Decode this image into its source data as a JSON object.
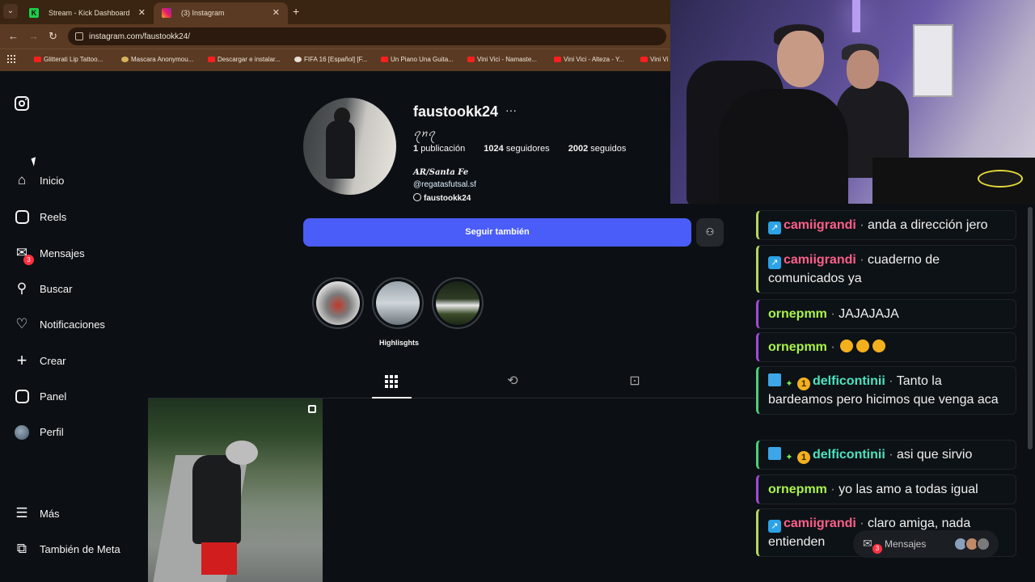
{
  "browser": {
    "tabs": [
      {
        "title": "Stream - Kick Dashboard",
        "favicon": "kick-icon",
        "active": false
      },
      {
        "title": "(3) Instagram",
        "favicon": "instagram-icon",
        "active": true
      }
    ],
    "new_tab_label": "+",
    "url": "instagram.com/faustookk24/",
    "bookmarks": [
      "Glitterati Lip Tattoo...",
      "Mascara Anonymou...",
      "Descargar e instalar...",
      "FIFA 16 [Español] [F...",
      "Un Piano Una Guita...",
      "Vini Vici - Namaste...",
      "Vini Vici - Alteza - Y...",
      "Vini Vi"
    ]
  },
  "instagram": {
    "sidebar": {
      "items": [
        {
          "label": "Inicio",
          "icon": "home-icon"
        },
        {
          "label": "Reels",
          "icon": "reels-icon"
        },
        {
          "label": "Mensajes",
          "icon": "messages-icon",
          "badge": "3"
        },
        {
          "label": "Buscar",
          "icon": "search-icon"
        },
        {
          "label": "Notificaciones",
          "icon": "heart-icon"
        },
        {
          "label": "Crear",
          "icon": "plus-icon"
        },
        {
          "label": "Panel",
          "icon": "dashboard-icon"
        },
        {
          "label": "Perfil",
          "icon": "avatar-icon"
        },
        {
          "label": "Más",
          "icon": "menu-icon"
        },
        {
          "label": "También de Meta",
          "icon": "meta-icon"
        }
      ]
    },
    "profile": {
      "username": "faustookk24",
      "more": "···",
      "signature": "ꪖꪀꪖ",
      "stats": {
        "posts": "1",
        "posts_label": "publicación",
        "followers": "1024",
        "followers_label": "seguidores",
        "following": "2002",
        "following_label": "seguidos"
      },
      "bio_location": "AR/Santa Fe",
      "bio_link": "@regatasfutsal.sf",
      "threads_handle": "faustookk24",
      "follow_button": "Seguir también",
      "highlights_label": "Highlisghts"
    }
  },
  "chat": {
    "messages": [
      {
        "user": "camiigrandi",
        "user_color": "#ff5f8a",
        "text": "anda a dirección jero",
        "badges": [
          "share"
        ]
      },
      {
        "user": "camiigrandi",
        "user_color": "#ff5f8a",
        "text": "cuaderno de comunicados ya",
        "badges": [
          "share"
        ]
      },
      {
        "user": "ornepmm",
        "user_color": "#aaf34a",
        "text": "JAJAJAJA",
        "badges": []
      },
      {
        "user": "ornepmm",
        "user_color": "#aaf34a",
        "text": "",
        "badges": [],
        "emotes": 3
      },
      {
        "user": "delficontinii",
        "user_color": "#4be5c1",
        "text": "Tanto la bardeamos pero hicimos que venga aca",
        "badges": [
          "cube",
          "star",
          "one"
        ]
      },
      {
        "user": "delficontinii",
        "user_color": "#4be5c1",
        "text": "asi que sirvio",
        "badges": [
          "cube",
          "star",
          "one"
        ]
      },
      {
        "user": "ornepmm",
        "user_color": "#aaf34a",
        "text": "yo las amo a todas igual",
        "badges": []
      },
      {
        "user": "camiigrandi",
        "user_color": "#ff5f8a",
        "text": "claro amiga, nada entienden",
        "badges": [
          "share"
        ]
      }
    ],
    "message_bar": {
      "label": "Mensajes",
      "badge": "3"
    }
  },
  "colors": {
    "follow_button": "#4a5df9",
    "browser_chrome": "#5a3a22",
    "background": "#0c1014"
  }
}
